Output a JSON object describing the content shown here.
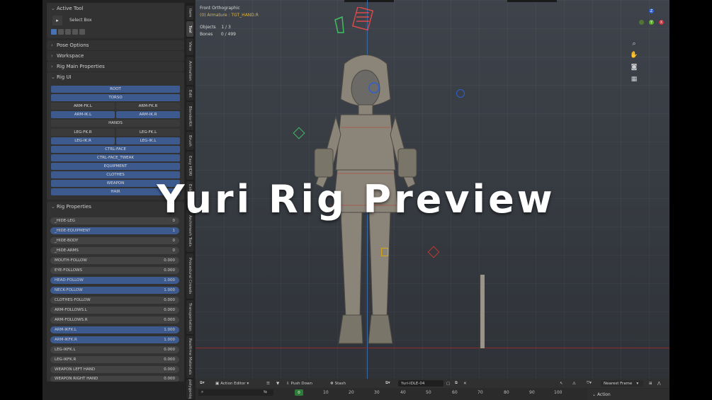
{
  "overlay": {
    "title": "Yuri Rig Preview"
  },
  "active_tool": {
    "header": "Active Tool",
    "tool_label": "Select Box"
  },
  "sections": {
    "pose_options": "Pose Options",
    "workspace": "Workspace",
    "rig_main_properties": "Rig Main Properties",
    "rig_ui": "Rig UI",
    "rig_properties": "Rig Properties"
  },
  "rig_ui_buttons": {
    "root": "ROOT",
    "torso": "TORSO",
    "arm_fk_l": "ARM-FK.L",
    "arm_fk_r": "ARM-FK.R",
    "arm_ik_l": "ARM-IK.L",
    "arm_ik_r": "ARM-IK.R",
    "hands": "HANDS",
    "leg_fk_r": "LEG-FK.R",
    "leg_fk_l": "LEG-FK.L",
    "leg_ik_r": "LEG-IK.R",
    "leg_ik_l": "LEG-IK.L",
    "ctrl_face": "CTRL-FACE",
    "ctrl_face_tweak": "CTRL-FACE_TWEAK",
    "equipment": "EQUIPMENT",
    "clothes": "CLOTHES",
    "weapon": "WEAPON",
    "hair": "HAIR"
  },
  "rig_properties": [
    {
      "label": "_HIDE-LEG",
      "value": "0"
    },
    {
      "label": "_HIDE-EQUIPMENT",
      "value": "1"
    },
    {
      "label": "_HIDE-BODY",
      "value": "0"
    },
    {
      "label": "_HIDE-ARMS",
      "value": "0"
    },
    {
      "label": "MOUTH-FOLLOW",
      "value": "0.000"
    },
    {
      "label": "EYE-FOLLOWS",
      "value": "0.000"
    },
    {
      "label": "HEAD-FOLLOW",
      "value": "1.000"
    },
    {
      "label": "NECK-FOLLOW",
      "value": "1.000"
    },
    {
      "label": "CLOTHES-FOLLOW",
      "value": "0.000"
    },
    {
      "label": "ARM-FOLLOWS.L",
      "value": "0.000"
    },
    {
      "label": "ARM-FOLLOWS.R",
      "value": "0.000"
    },
    {
      "label": "ARM-IKFK.L",
      "value": "1.000"
    },
    {
      "label": "ARM-IKFK.R",
      "value": "1.000"
    },
    {
      "label": "LEG-IKFK.L",
      "value": "0.000"
    },
    {
      "label": "LEG-IKFK.R",
      "value": "0.000"
    },
    {
      "label": "WEAPON LEFT HAND",
      "value": "0.000"
    },
    {
      "label": "WEAPON RIGHT HAND",
      "value": "0.000"
    }
  ],
  "vertical_tabs": [
    "Item",
    "Tool",
    "View",
    "Animation",
    "Edit",
    "BlenderKit",
    "Brush",
    "Easy HDRI",
    "Extras",
    "Archimesh Tools",
    "Procedural Crowds",
    "Transportation",
    "Realtime Materials",
    "polygoniq"
  ],
  "viewport": {
    "view_name": "Front Orthographic",
    "active_object": "(0) Armature : TGT_HAND.R",
    "objects_label": "Objects",
    "objects_value": "1 / 3",
    "bones_label": "Bones",
    "bones_value": "0 / 499",
    "gizmo": {
      "x": "X",
      "y": "Y",
      "z": "Z"
    }
  },
  "timeline": {
    "editor_type": "Action Editor",
    "push_down": "Push Down",
    "stash": "Stash",
    "action_name": "Yuri-IDLE-04",
    "interpolation": "Nearest Frame",
    "side_panel": "Action",
    "current_frame": "0",
    "ticks": [
      "10",
      "20",
      "30",
      "40",
      "50",
      "60",
      "70",
      "80",
      "90",
      "100"
    ]
  },
  "colors": {
    "accent_blue": "#3d5a8f",
    "active_object_text": "#e0b43c",
    "x_axis": "#8c2c2c",
    "y_axis": "#3a6aa5",
    "current_frame": "#2e7b3a"
  }
}
